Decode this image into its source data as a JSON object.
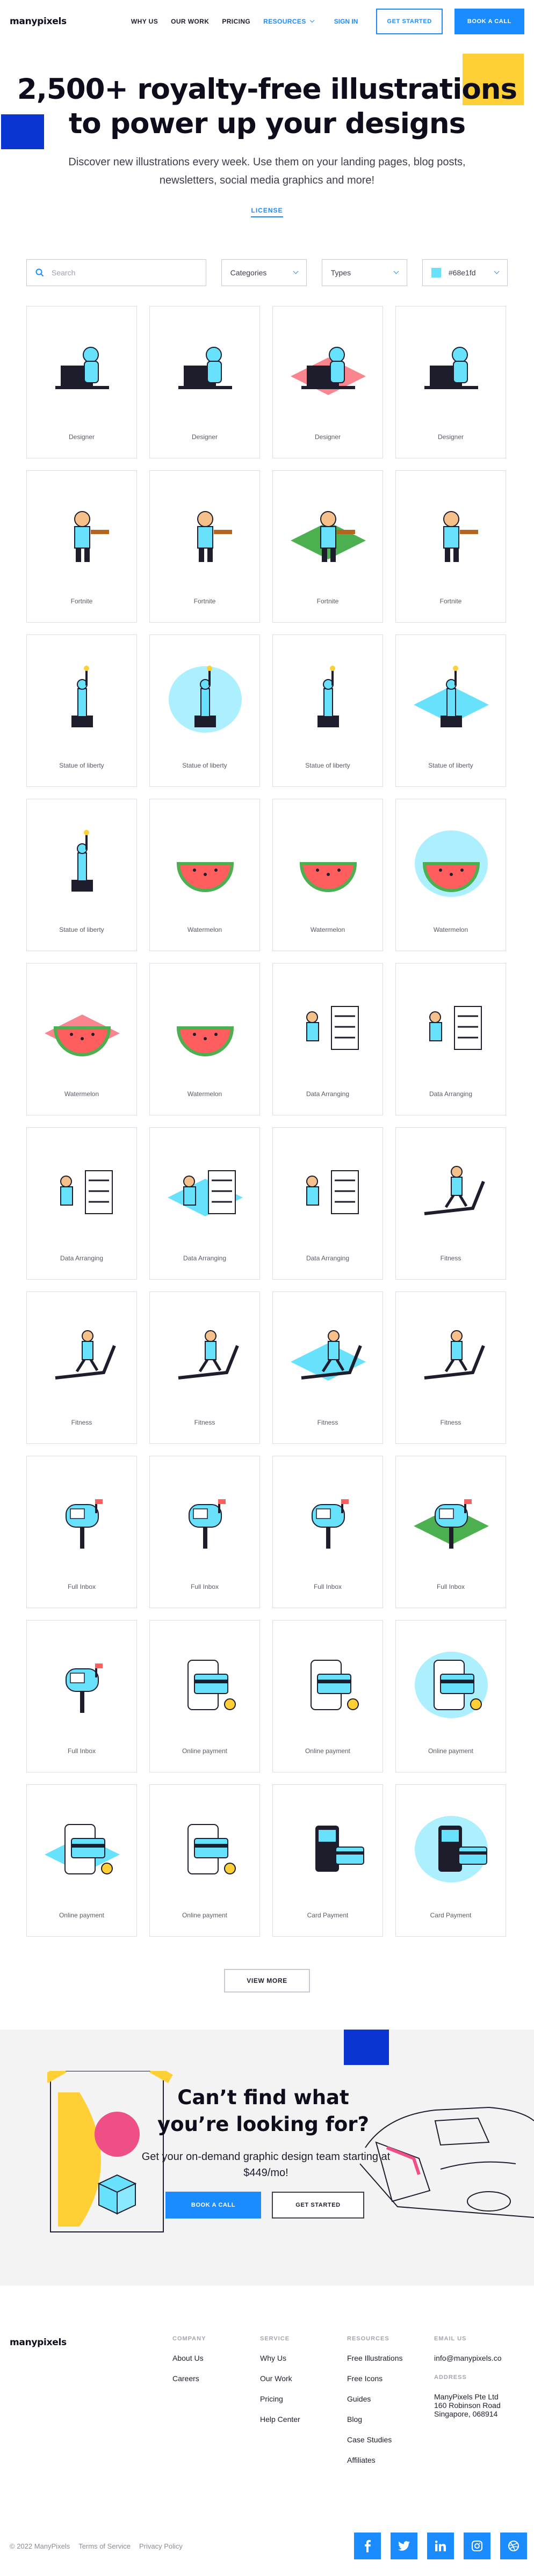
{
  "nav": {
    "logo": "manypixels",
    "links": [
      "WHY US",
      "OUR WORK",
      "PRICING"
    ],
    "resources": "RESOURCES",
    "sign_in": "SIGN IN",
    "get_started": "GET STARTED",
    "book_call": "BOOK A CALL"
  },
  "hero": {
    "title_line1": "2,500+ royalty-free illustrations",
    "title_line2": "to power up your designs",
    "subtitle": "Discover new illustrations every week. Use them on your landing pages, blog posts, newsletters, social media graphics and more!",
    "license": "LICENSE"
  },
  "filters": {
    "search_placeholder": "Search",
    "categories": "Categories",
    "types": "Types",
    "color_value": "#68e1fd",
    "color_hex": "#68e1fd"
  },
  "illustrations": [
    {
      "caption": "Designer",
      "icon": "designer-at-laptop"
    },
    {
      "caption": "Designer",
      "icon": "designer-with-palette"
    },
    {
      "caption": "Designer",
      "icon": "designer-isometric-desk"
    },
    {
      "caption": "Designer",
      "icon": "designer-on-beanbag"
    },
    {
      "caption": "Fortnite",
      "icon": "fortnite-sketch"
    },
    {
      "caption": "Fortnite",
      "icon": "fortnite-character"
    },
    {
      "caption": "Fortnite",
      "icon": "fortnite-isometric-island"
    },
    {
      "caption": "Fortnite",
      "icon": "fortnite-dance"
    },
    {
      "caption": "Statue of liberty",
      "icon": "liberty-outline"
    },
    {
      "caption": "Statue of liberty",
      "icon": "liberty-circle"
    },
    {
      "caption": "Statue of liberty",
      "icon": "liberty-skyline"
    },
    {
      "caption": "Statue of liberty",
      "icon": "liberty-isometric"
    },
    {
      "caption": "Statue of liberty",
      "icon": "liberty-city"
    },
    {
      "caption": "Watermelon",
      "icon": "watermelon-person"
    },
    {
      "caption": "Watermelon",
      "icon": "watermelon-slice"
    },
    {
      "caption": "Watermelon",
      "icon": "watermelon-picnic-blob"
    },
    {
      "caption": "Watermelon",
      "icon": "watermelon-isometric-picnic"
    },
    {
      "caption": "Watermelon",
      "icon": "watermelon-yoga"
    },
    {
      "caption": "Data Arranging",
      "icon": "data-shelves"
    },
    {
      "caption": "Data Arranging",
      "icon": "data-folders"
    },
    {
      "caption": "Data Arranging",
      "icon": "data-person-desk"
    },
    {
      "caption": "Data Arranging",
      "icon": "data-isometric-blocks"
    },
    {
      "caption": "Data Arranging",
      "icon": "data-building"
    },
    {
      "caption": "Fitness",
      "icon": "fitness-treadmill-outline"
    },
    {
      "caption": "Fitness",
      "icon": "fitness-bench-press"
    },
    {
      "caption": "Fitness",
      "icon": "fitness-treadmill-runner"
    },
    {
      "caption": "Fitness",
      "icon": "fitness-isometric-yoga"
    },
    {
      "caption": "Fitness",
      "icon": "fitness-treadmill-sprint"
    },
    {
      "caption": "Full Inbox",
      "icon": "inbox-mailbox-flowers"
    },
    {
      "caption": "Full Inbox",
      "icon": "inbox-envelope"
    },
    {
      "caption": "Full Inbox",
      "icon": "inbox-mailbox-letters"
    },
    {
      "caption": "Full Inbox",
      "icon": "inbox-isometric-mailbox"
    },
    {
      "caption": "Full Inbox",
      "icon": "inbox-mailbox-bird"
    },
    {
      "caption": "Online payment",
      "icon": "payment-phone-card"
    },
    {
      "caption": "Online payment",
      "icon": "payment-screen-card"
    },
    {
      "caption": "Online payment",
      "icon": "payment-tablet-hand"
    },
    {
      "caption": "Online payment",
      "icon": "payment-isometric-laptop"
    },
    {
      "caption": "Online payment",
      "icon": "payment-phone-coin"
    },
    {
      "caption": "Card Payment",
      "icon": "card-terminal"
    },
    {
      "caption": "Card Payment",
      "icon": "card-hand-tap"
    }
  ],
  "view_more": "VIEW MORE",
  "cta": {
    "title": "Can’t find what you’re looking for?",
    "subtitle": "Get your on-demand graphic design team starting at $449/mo!",
    "book_call": "BOOK A CALL",
    "get_started": "GET STARTED"
  },
  "footer": {
    "logo": "manypixels",
    "company": {
      "heading": "COMPANY",
      "links": [
        "About Us",
        "Careers"
      ]
    },
    "service": {
      "heading": "SERVICE",
      "links": [
        "Why Us",
        "Our Work",
        "Pricing",
        "Help Center"
      ]
    },
    "resources": {
      "heading": "RESOURCES",
      "links": [
        "Free Illustrations",
        "Free Icons",
        "Guides",
        "Blog",
        "Case Studies",
        "Affiliates"
      ]
    },
    "email": {
      "heading": "EMAIL US",
      "value": "info@manypixels.co"
    },
    "address": {
      "heading": "ADDRESS",
      "line1": "ManyPixels Pte Ltd",
      "line2": "160 Robinson Road",
      "line3": "Singapore, 068914"
    },
    "copyright": "© 2022 ManyPixels",
    "terms": "Terms of Service",
    "privacy": "Privacy Policy",
    "socials": [
      "facebook-icon",
      "twitter-icon",
      "linkedin-icon",
      "instagram-icon",
      "dribbble-icon"
    ]
  },
  "colors": {
    "accent": "#1a8cff",
    "hero_yellow": "#ffd036",
    "deep_blue": "#0b35d3",
    "illustration_cyan": "#68e1fd",
    "pink": "#f9858f",
    "green": "#4caf50"
  }
}
